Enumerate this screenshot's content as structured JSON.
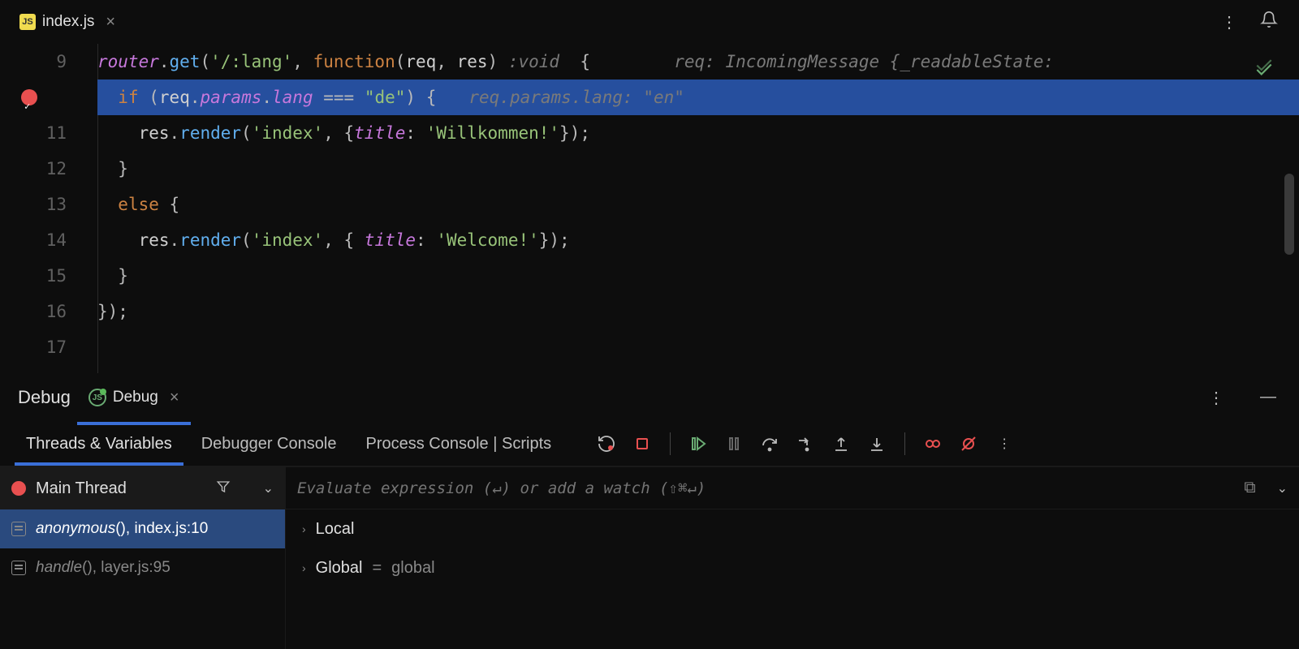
{
  "tab": {
    "filename": "index.js",
    "icon_text": "JS"
  },
  "code": {
    "line_numbers": [
      "9",
      "",
      "11",
      "12",
      "13",
      "14",
      "15",
      "16",
      "17"
    ],
    "breakpoint_line_index": 1,
    "lines": {
      "l9": {
        "router": "router",
        "dot1": ".",
        "get": "get",
        "open": "(",
        "route": "'/:lang'",
        "comma": ", ",
        "fn": "function",
        "open2": "(",
        "req": "req",
        "comma2": ", ",
        "res": "res",
        "close2": ")",
        "space": " ",
        "hint": ":void",
        "space2": "  ",
        "brace": "{",
        "spaces": "     ",
        "inline": "req: IncomingMessage {_readableState: "
      },
      "l10": {
        "indent": "  ",
        "if": "if",
        "space": " ",
        "open": "(",
        "req": "req",
        "dot1": ".",
        "params": "params",
        "dot2": ".",
        "lang": "lang",
        "space2": " ",
        "eq": "===",
        "space3": " ",
        "str": "\"de\"",
        "close": ")",
        "space4": " ",
        "brace": "{",
        "inline": "req.params.lang: \"en\""
      },
      "l11": {
        "indent": "    ",
        "res": "res",
        "dot": ".",
        "render": "render",
        "open": "(",
        "str1": "'index'",
        "comma": ", ",
        "brace": "{",
        "title": "title",
        "colon": ": ",
        "str2": "'Willkommen!'",
        "cbrace": "}",
        "close": ");"
      },
      "l12": {
        "indent": "  ",
        "brace": "}"
      },
      "l13": {
        "indent": "  ",
        "else": "else",
        "space": " ",
        "brace": "{"
      },
      "l14": {
        "indent": "    ",
        "res": "res",
        "dot": ".",
        "render": "render",
        "open": "(",
        "str1": "'index'",
        "comma": ", ",
        "brace": "{ ",
        "title": "title",
        "colon": ": ",
        "str2": "'Welcome!'",
        "cbrace": "}",
        "close": ");"
      },
      "l15": {
        "indent": "  ",
        "brace": "}"
      },
      "l16": {
        "close": "});"
      }
    }
  },
  "debug": {
    "title": "Debug",
    "session_name": "Debug",
    "tabs": [
      "Threads & Variables",
      "Debugger Console",
      "Process Console",
      "Scripts"
    ],
    "active_tab": 0,
    "thread": "Main Thread",
    "frames": [
      {
        "fn": "anonymous",
        "suffix": "(), index.js:10",
        "active": true
      },
      {
        "fn": "handle",
        "suffix": "(), layer.js:95",
        "active": false
      }
    ],
    "eval_placeholder": "Evaluate expression (↵) or add a watch (⇧⌘↵)",
    "vars": [
      {
        "name": "Local",
        "eq": "",
        "val": ""
      },
      {
        "name": "Global",
        "eq": " = ",
        "val": "global"
      }
    ]
  }
}
